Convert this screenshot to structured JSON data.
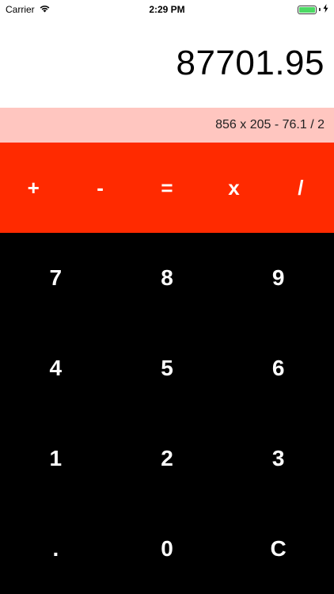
{
  "status_bar": {
    "carrier": "Carrier",
    "time": "2:29 PM",
    "battery_level": 1.0,
    "battery_color": "#4cd964"
  },
  "display": {
    "result": "87701.95",
    "expression": "856 x 205 - 76.1 / 2"
  },
  "operators": [
    {
      "label": "+",
      "name": "plus"
    },
    {
      "label": "-",
      "name": "minus"
    },
    {
      "label": "=",
      "name": "equals"
    },
    {
      "label": "x",
      "name": "multiply"
    },
    {
      "label": "/",
      "name": "divide"
    }
  ],
  "keys": [
    {
      "label": "7",
      "name": "seven"
    },
    {
      "label": "8",
      "name": "eight"
    },
    {
      "label": "9",
      "name": "nine"
    },
    {
      "label": "4",
      "name": "four"
    },
    {
      "label": "5",
      "name": "five"
    },
    {
      "label": "6",
      "name": "six"
    },
    {
      "label": "1",
      "name": "one"
    },
    {
      "label": "2",
      "name": "two"
    },
    {
      "label": "3",
      "name": "three"
    },
    {
      "label": ".",
      "name": "decimal"
    },
    {
      "label": "0",
      "name": "zero"
    },
    {
      "label": "C",
      "name": "clear"
    }
  ],
  "colors": {
    "operator_row": "#ff2a00",
    "expression_bar": "#ffc6c0",
    "keypad": "#000000"
  },
  "icons": {
    "wifi": "wifi-icon",
    "battery": "battery-icon",
    "charging": "charging-bolt-icon"
  }
}
